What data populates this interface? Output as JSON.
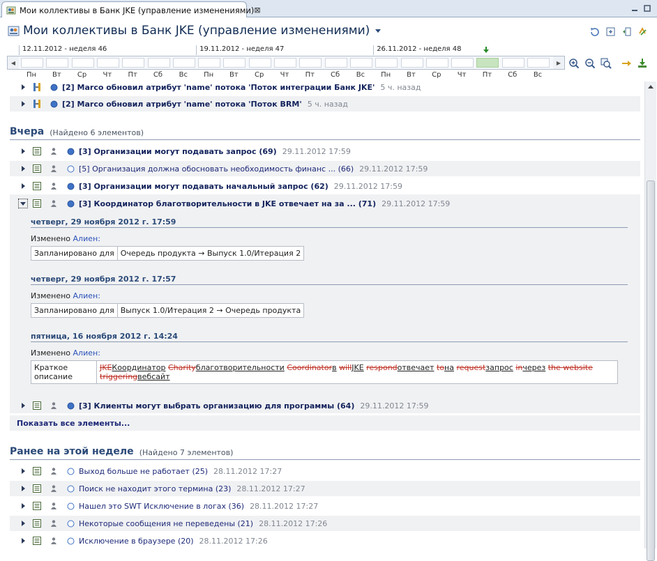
{
  "tab": {
    "label": "Мои коллективы в Банк JKE (управление изменениями)",
    "close": "⊠"
  },
  "header": {
    "title": "Мои коллективы в Банк JKE (управление изменениями)"
  },
  "timeline": {
    "weeks": [
      "12.11.2012 - неделя 46",
      "19.11.2012 - неделя 47",
      "26.11.2012 - неделя 48"
    ],
    "days": [
      "Пн",
      "Вт",
      "Ср",
      "Чт",
      "Пт",
      "Сб",
      "Вс",
      "Пн",
      "Вт",
      "Ср",
      "Чт",
      "Пт",
      "Сб",
      "Вс",
      "Пн",
      "Вт",
      "Ср",
      "Чт",
      "Пт",
      "Сб",
      "Вс"
    ],
    "today_index": 18,
    "accent": "#c7e4be"
  },
  "earlier_today": [
    {
      "text": "[2] Marco обновил атрибут 'name' потока 'Поток интеграции Банк JKE'",
      "meta": "5 ч. назад"
    },
    {
      "text": "[2] Marco обновил атрибут 'name' потока 'Поток BRM'",
      "meta": "5 ч. назад"
    }
  ],
  "yesterday": {
    "title": "Вчера",
    "count": "(Найдено 6 элементов)",
    "items": [
      {
        "text": "[3] Организации могут подавать запрос (69)",
        "meta": "29.11.2012 17:59",
        "bold": true,
        "filled": true
      },
      {
        "text": "[5] Организация должна обосновать необходимость финанс ... (66)",
        "meta": "29.11.2012 17:59",
        "bold": false,
        "filled": false
      },
      {
        "text": "[3] Организации могут подавать начальный запрос (62)",
        "meta": "29.11.2012 17:59",
        "bold": true,
        "filled": true
      },
      {
        "text": "[3] Координатор благотворительности в JKE отвечает на за ... (71)",
        "meta": "29.11.2012 17:59",
        "bold": true,
        "filled": true
      }
    ],
    "changes": [
      {
        "date": "четверг, 29 ноября 2012 г. 17:59",
        "by_label": "Изменено",
        "author": "Алиен:",
        "field": "Запланировано для",
        "value": "Очередь продукта → Выпуск 1.0/Итерация 2"
      },
      {
        "date": "четверг, 29 ноября 2012 г. 17:57",
        "by_label": "Изменено",
        "author": "Алиен:",
        "field": "Запланировано для",
        "value": "Выпуск 1.0/Итерация 2 → Очередь продукта"
      },
      {
        "date": "пятница, 16 ноября 2012 г. 14:24",
        "by_label": "Изменено",
        "author": "Алиен:",
        "field": "Краткое описание"
      }
    ],
    "diff_tokens": [
      {
        "t": "JKE",
        "k": "del"
      },
      {
        "t": "Координатор",
        "k": "ins"
      },
      {
        "t": " ",
        "k": ""
      },
      {
        "t": "Charity",
        "k": "del"
      },
      {
        "t": "благотворительности",
        "k": "ins"
      },
      {
        "t": " ",
        "k": ""
      },
      {
        "t": "Coordinator",
        "k": "del"
      },
      {
        "t": "в",
        "k": "ins"
      },
      {
        "t": " ",
        "k": ""
      },
      {
        "t": "will",
        "k": "del"
      },
      {
        "t": "JKE",
        "k": "ins"
      },
      {
        "t": " ",
        "k": ""
      },
      {
        "t": "respond",
        "k": "del"
      },
      {
        "t": "отвечает",
        "k": "ins"
      },
      {
        "t": " ",
        "k": ""
      },
      {
        "t": "to",
        "k": "del"
      },
      {
        "t": "на",
        "k": "ins"
      },
      {
        "t": " ",
        "k": ""
      },
      {
        "t": "request",
        "k": "del"
      },
      {
        "t": "запрос",
        "k": "ins"
      },
      {
        "t": " ",
        "k": ""
      },
      {
        "t": "in",
        "k": "del"
      },
      {
        "t": "через",
        "k": "ins"
      },
      {
        "t": " ",
        "k": ""
      },
      {
        "t": "the website",
        "k": "del"
      },
      {
        "t": " ",
        "k": ""
      },
      {
        "t": "triggering",
        "k": "del"
      },
      {
        "t": "вебсайт",
        "k": "ins"
      }
    ],
    "after_item": {
      "text": "[3] Клиенты могут выбрать организацию для программы (64)",
      "meta": "29.11.2012 17:59"
    },
    "show_all": "Показать все элементы..."
  },
  "this_week": {
    "title": "Ранее на этой неделе",
    "count": "(Найдено 7 элементов)",
    "items": [
      {
        "text": "Выход больше не работает (25)",
        "meta": "28.11.2012 17:27"
      },
      {
        "text": "Поиск не находит этого термина (23)",
        "meta": "28.11.2012 17:27"
      },
      {
        "text": "Нашел это SWT Исключение в логах (36)",
        "meta": "28.11.2012 17:27"
      },
      {
        "text": "Некоторые сообщения не переведены (21)",
        "meta": "28.11.2012 17:26"
      },
      {
        "text": "Исключение в браузере (20)",
        "meta": "28.11.2012 17:26"
      }
    ]
  }
}
